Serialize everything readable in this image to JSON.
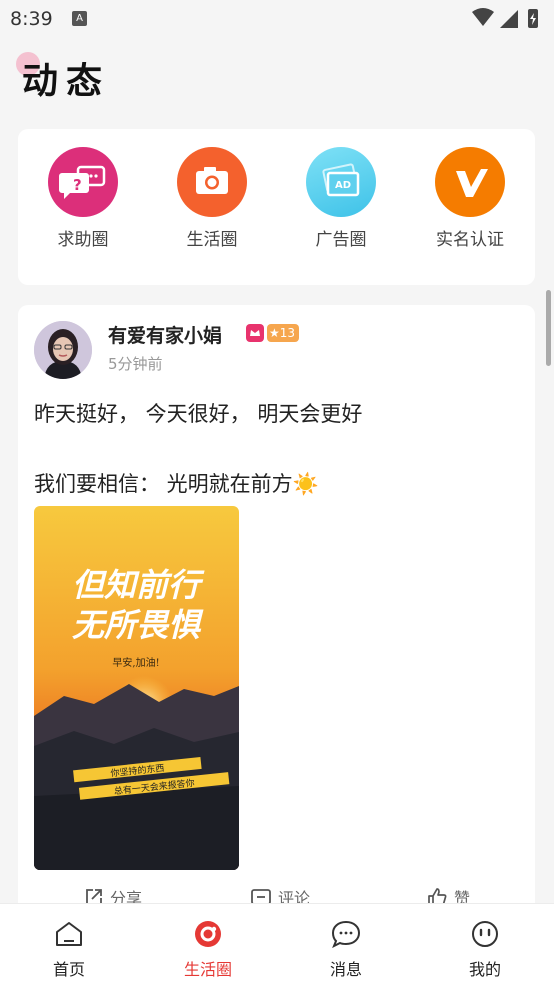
{
  "status_bar": {
    "time": "8:39",
    "notification_letter": "A"
  },
  "header": {
    "title": "动态"
  },
  "circles": [
    {
      "label": "求助圈",
      "icon": "help-chat-icon",
      "color": "#dc2f7a"
    },
    {
      "label": "生活圈",
      "icon": "camera-icon",
      "color": "#f4612d"
    },
    {
      "label": "广告圈",
      "icon": "ad-icon",
      "color": "#5fd0ee"
    },
    {
      "label": "实名认证",
      "icon": "v-verify-icon",
      "color": "#f57c00"
    }
  ],
  "post": {
    "user_name": "有爱有家小娟",
    "level": "13",
    "time": "5分钟前",
    "text_line1": "昨天挺好， 今天很好， 明天会更好",
    "text_line2": "我们要相信： 光明就在前方☀️",
    "image": {
      "headline1": "但知前行",
      "headline2": "无所畏惧",
      "subtitle": "早安,加油!",
      "banner1": "你坚持的东西",
      "banner2": "总有一天会来报答你"
    },
    "actions": {
      "share": "分享",
      "comment": "评论",
      "like": "赞"
    }
  },
  "bottom_nav": [
    {
      "label": "首页",
      "icon": "home-icon",
      "active": false
    },
    {
      "label": "生活圈",
      "icon": "life-circle-icon",
      "active": true
    },
    {
      "label": "消息",
      "icon": "message-icon",
      "active": false
    },
    {
      "label": "我的",
      "icon": "profile-icon",
      "active": false
    }
  ],
  "colors": {
    "accent": "#e53935",
    "background": "#f5f5f5"
  }
}
